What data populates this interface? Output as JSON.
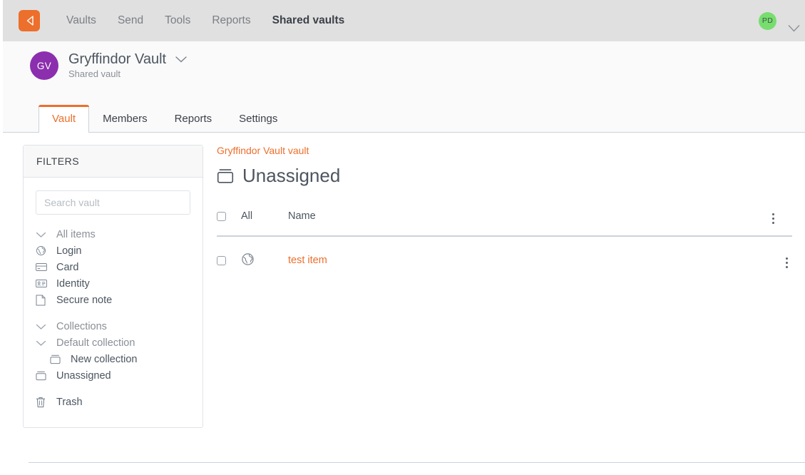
{
  "topnav": {
    "logo_icon": "bitwarden-shield-icon",
    "links": [
      {
        "label": "Vaults",
        "active": false
      },
      {
        "label": "Send",
        "active": false
      },
      {
        "label": "Tools",
        "active": false
      },
      {
        "label": "Reports",
        "active": false
      },
      {
        "label": "Shared vaults",
        "active": true
      }
    ],
    "avatar_initials": "PD",
    "avatar_color": "#77dd6f",
    "caret_icon": "chevron-down-icon"
  },
  "vault_header": {
    "avatar_initials": "GV",
    "avatar_color": "#8b2fae",
    "title": "Gryffindor Vault",
    "subtitle": "Shared vault",
    "chevron_icon": "chevron-down-icon",
    "tabs": [
      {
        "label": "Vault",
        "active": true
      },
      {
        "label": "Members",
        "active": false
      },
      {
        "label": "Reports",
        "active": false
      },
      {
        "label": "Settings",
        "active": false
      }
    ]
  },
  "filters": {
    "header": "FILTERS",
    "search_placeholder": "Search vault",
    "search_value": "",
    "types_group": [
      {
        "label": "All items",
        "icon": "chevron-down-icon",
        "muted": true,
        "indent": false
      },
      {
        "label": "Login",
        "icon": "globe-icon",
        "muted": false,
        "indent": false
      },
      {
        "label": "Card",
        "icon": "credit-card-icon",
        "muted": false,
        "indent": false
      },
      {
        "label": "Identity",
        "icon": "id-card-icon",
        "muted": false,
        "indent": false
      },
      {
        "label": "Secure note",
        "icon": "note-icon",
        "muted": false,
        "indent": false
      }
    ],
    "collections_group": [
      {
        "label": "Collections",
        "icon": "chevron-down-icon",
        "muted": true,
        "indent": false
      },
      {
        "label": "Default collection",
        "icon": "chevron-down-icon",
        "muted": true,
        "indent": false
      },
      {
        "label": "New collection",
        "icon": "collection-icon",
        "muted": false,
        "indent": true
      },
      {
        "label": "Unassigned",
        "icon": "collection-icon",
        "muted": false,
        "indent": false
      }
    ],
    "trash_group": [
      {
        "label": "Trash",
        "icon": "trash-icon",
        "muted": false,
        "indent": false
      }
    ]
  },
  "main": {
    "breadcrumb": "Gryffindor Vault vault",
    "title": "Unassigned",
    "title_icon": "collection-icon",
    "table": {
      "header_checkbox_label": "All",
      "columns": [
        "Name"
      ],
      "header_menu_icon": "kebab-menu-icon",
      "rows": [
        {
          "name": "test item",
          "icon": "globe-icon",
          "menu_icon": "kebab-menu-icon",
          "checked": false
        }
      ]
    }
  },
  "colors": {
    "accent": "#ec6f2c",
    "nav_bg": "#e0e0e0",
    "header_bg": "#fafafa",
    "text": "#4c5560",
    "muted": "#8a8f96",
    "border": "#c9d2dc"
  }
}
